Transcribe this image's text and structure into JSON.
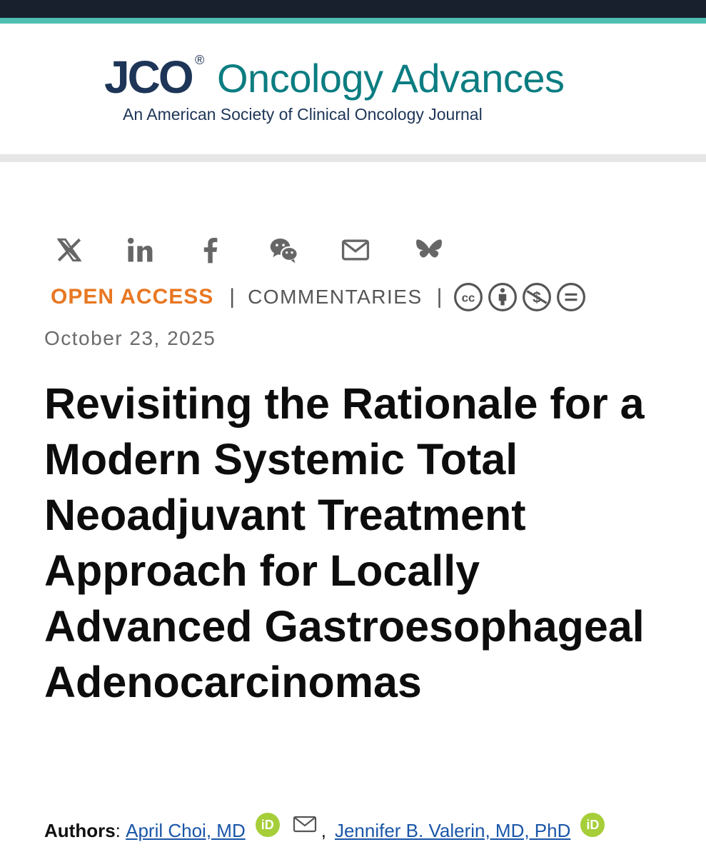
{
  "header": {
    "logo_jco": "JCO",
    "logo_reg": "®",
    "journal_name": "Oncology Advances",
    "journal_subtitle": "An American Society of Clinical Oncology Journal",
    "colors": {
      "navy": "#1d3557",
      "teal": "#0b7d81",
      "accent_line": "#4fbfb2"
    }
  },
  "share": {
    "icons": [
      "x-icon",
      "linkedin-icon",
      "facebook-icon",
      "wechat-icon",
      "email-icon",
      "bluesky-icon"
    ]
  },
  "article": {
    "access": "OPEN ACCESS",
    "separator": "|",
    "category": "COMMENTARIES",
    "license_icons": [
      "cc-icon",
      "by-attribution-icon",
      "noncommercial-icon",
      "noderivatives-icon"
    ],
    "date": "October 23, 2025",
    "title": "Revisiting the Rationale for a Modern Systemic Total Neoadjuvant Treatment Approach for Locally Advanced Gastroesophageal Adenocarcinomas",
    "authors_label": "Authors",
    "authors_colon": ": ",
    "authors": [
      {
        "name": "April Choi, MD",
        "orcid": "iD"
      },
      {
        "name": "Jennifer B. Valerin, MD, PhD",
        "orcid": "iD"
      }
    ],
    "author_separator": ","
  }
}
